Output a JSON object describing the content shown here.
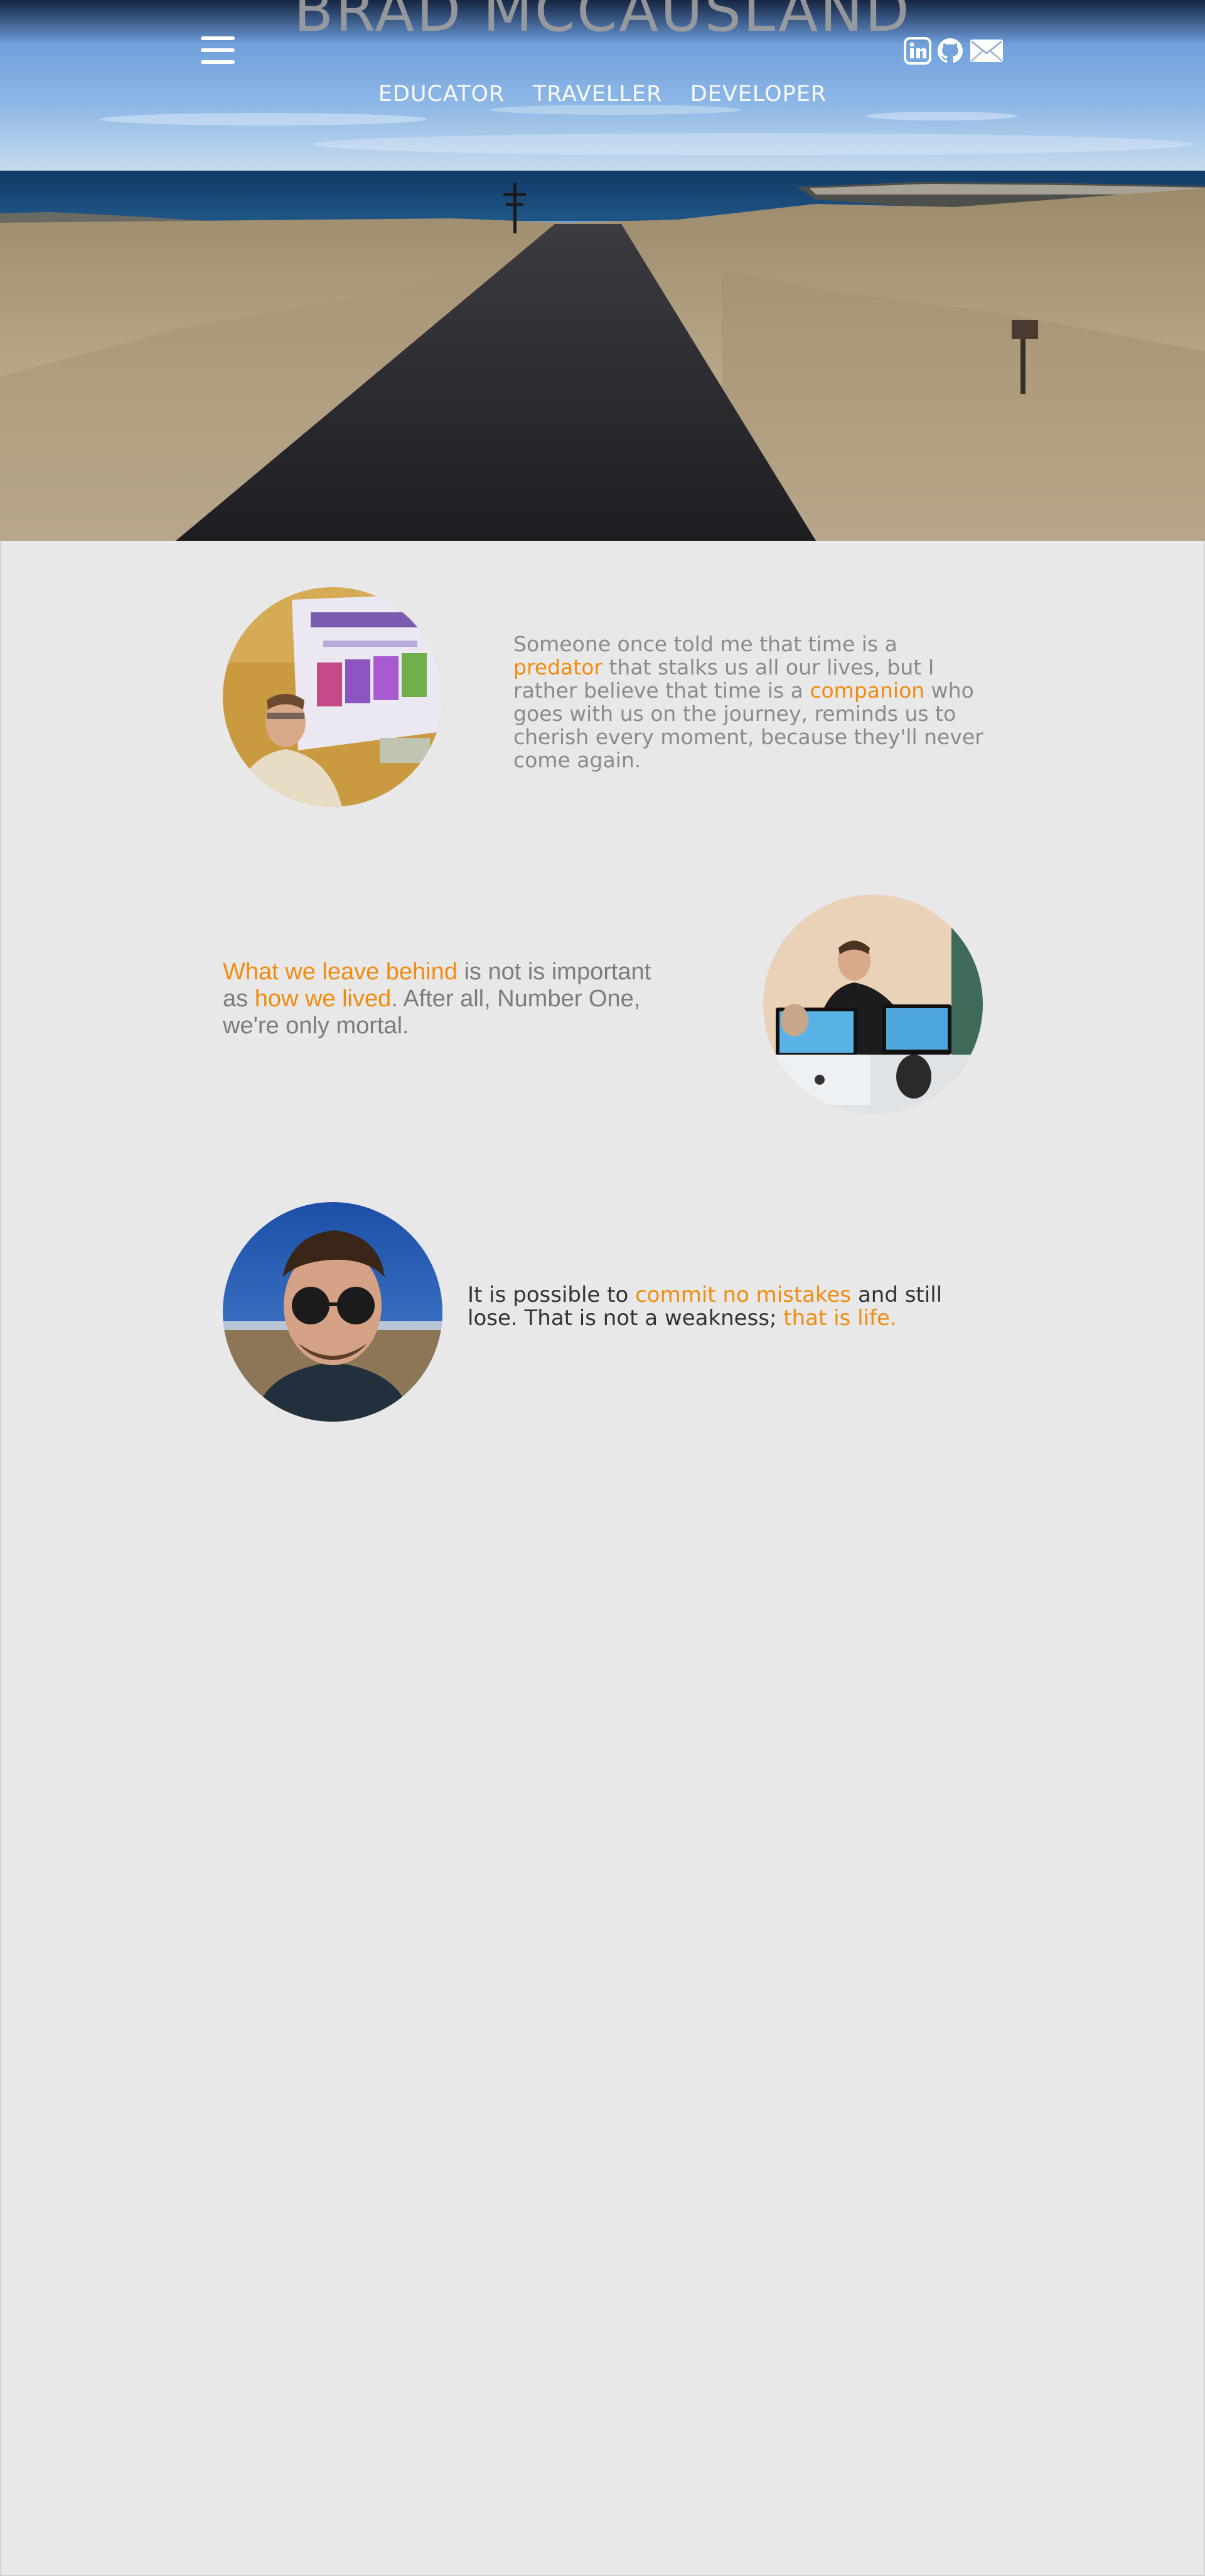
{
  "header": {
    "site_title": "BRAD MCCAUSLAND",
    "nav": [
      "EDUCATOR",
      "TRAVELLER",
      "DEVELOPER"
    ],
    "menu_icon": "hamburger-menu-icon",
    "social_icons": [
      "linkedin-icon",
      "github-icon",
      "email-icon"
    ]
  },
  "quotes": [
    {
      "parts": [
        "Someone once told me that time is a ",
        "predator",
        " that stalks us all our lives, but I rather believe that time is a ",
        "companion",
        " who goes with us on the journey, reminds us to cherish every moment, because they'll never come again."
      ]
    },
    {
      "parts": [
        "What we leave behind",
        " is not is important as ",
        "how we lived",
        ". After all, Number One, we're only mortal."
      ]
    },
    {
      "parts": [
        "It is possible to ",
        "commit no mistakes",
        " and still lose. That is not a weakness; ",
        "that is life."
      ]
    }
  ],
  "colors": {
    "accent": "#f08c10",
    "background": "#e8e8e9",
    "quote_gray": "#8a8a8a",
    "quote_dark": "#333333"
  }
}
